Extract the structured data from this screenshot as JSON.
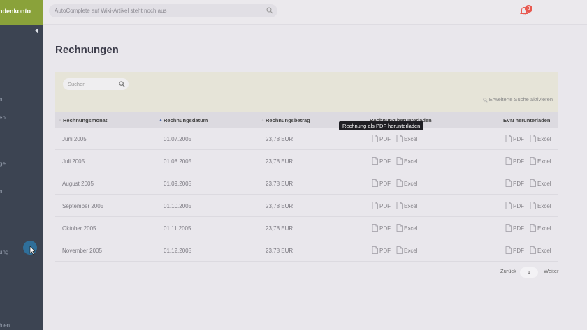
{
  "sidebar": {
    "brand": "ndenkonto",
    "items": [
      {
        "label": "n"
      },
      {
        "label": "en"
      },
      {
        "label": "ge"
      },
      {
        "label": "n"
      },
      {
        "label": "ung"
      },
      {
        "label": "hlen"
      }
    ]
  },
  "topbar": {
    "search_placeholder": "AutoComplete auf Wiki-Artikel steht noch aus",
    "notification_count": "3"
  },
  "page": {
    "title": "Rechnungen"
  },
  "filter": {
    "search_placeholder": "Suchen",
    "advanced_search": "Erweiterte Suche aktivieren"
  },
  "table": {
    "headers": {
      "month": "Rechnungsmonat",
      "date": "Rechnungsdatum",
      "amount": "Rechnungsbetrag",
      "download": "Rechnung herunterladen",
      "evn": "EVN herunterladen"
    },
    "pdf_label": "PDF",
    "excel_label": "Excel",
    "rows": [
      {
        "month": "Juni 2005",
        "date": "01.07.2005",
        "amount": "23,78 EUR"
      },
      {
        "month": "Juli 2005",
        "date": "01.08.2005",
        "amount": "23,78 EUR"
      },
      {
        "month": "August 2005",
        "date": "01.09.2005",
        "amount": "23,78 EUR"
      },
      {
        "month": "September 2005",
        "date": "01.10.2005",
        "amount": "23,78 EUR"
      },
      {
        "month": "Oktober 2005",
        "date": "01.11.2005",
        "amount": "23,78 EUR"
      },
      {
        "month": "November 2005",
        "date": "01.12.2005",
        "amount": "23,78 EUR"
      }
    ]
  },
  "tooltip": {
    "text": "Rechnung als PDF herunterladen"
  },
  "pagination": {
    "prev": "Zurück",
    "current": "1",
    "next": "Weiter"
  },
  "colors": {
    "sidebar": "#3c4452",
    "brand": "#8aa23a",
    "filter_panel": "#e6e4d8",
    "badge": "#e8584f",
    "sort_active": "#4e69a8"
  },
  "icons": [
    "search-icon",
    "bell-icon",
    "collapse-arrow-icon",
    "file-pdf-icon",
    "file-excel-icon",
    "pointer-cursor-icon"
  ]
}
